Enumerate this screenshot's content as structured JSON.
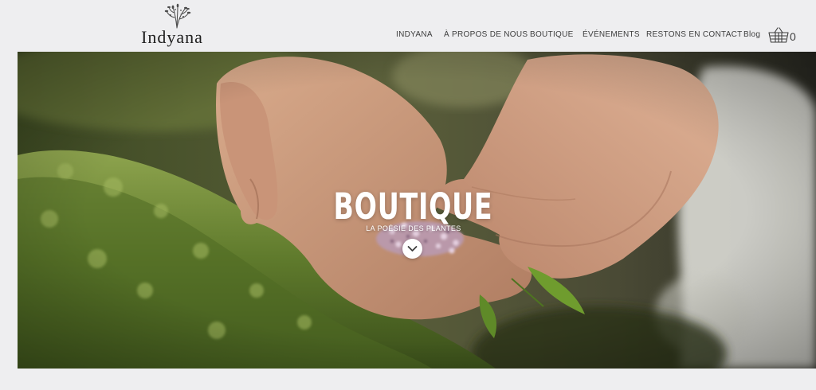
{
  "header": {
    "logo_text": "Indyana",
    "logo_icon": "herb-sprig-icon",
    "nav": [
      {
        "label": "INDYANA"
      },
      {
        "label": "À PROPOS DE NOUS"
      },
      {
        "label": "BOUTIQUE"
      },
      {
        "label": "ÉVÉNEMENTS"
      },
      {
        "label": "RESTONS EN CONTACT"
      },
      {
        "label": "Blog"
      }
    ],
    "cart": {
      "icon": "shopping-basket-icon",
      "count": "0"
    }
  },
  "hero": {
    "title": "BOUTIQUE",
    "subtitle": "LA POÉSIE DES PLANTES",
    "scroll_icon": "chevron-down-icon",
    "image": "hands-holding-flowers-over-moss"
  },
  "colors": {
    "background": "#eeeef0",
    "text": "#3d3d3d",
    "logo": "#1f1f1f",
    "hero_text": "#ffffff"
  }
}
